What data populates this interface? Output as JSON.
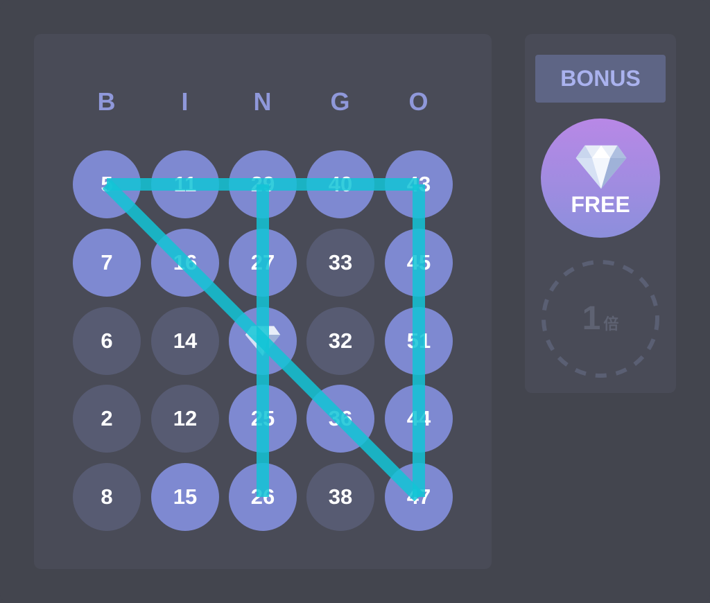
{
  "headers": [
    "B",
    "I",
    "N",
    "G",
    "O"
  ],
  "board": {
    "rows": [
      [
        {
          "label": "5",
          "marked": true
        },
        {
          "label": "11",
          "marked": true
        },
        {
          "label": "29",
          "marked": true
        },
        {
          "label": "40",
          "marked": true
        },
        {
          "label": "43",
          "marked": true
        }
      ],
      [
        {
          "label": "7",
          "marked": true
        },
        {
          "label": "16",
          "marked": true
        },
        {
          "label": "27",
          "marked": true
        },
        {
          "label": "33",
          "marked": false
        },
        {
          "label": "45",
          "marked": true
        }
      ],
      [
        {
          "label": "6",
          "marked": false
        },
        {
          "label": "14",
          "marked": false
        },
        {
          "label": "",
          "marked": true,
          "free": true
        },
        {
          "label": "32",
          "marked": false
        },
        {
          "label": "51",
          "marked": true
        }
      ],
      [
        {
          "label": "2",
          "marked": false
        },
        {
          "label": "12",
          "marked": false
        },
        {
          "label": "25",
          "marked": true
        },
        {
          "label": "36",
          "marked": true
        },
        {
          "label": "44",
          "marked": true
        }
      ],
      [
        {
          "label": "8",
          "marked": false
        },
        {
          "label": "15",
          "marked": true
        },
        {
          "label": "26",
          "marked": true
        },
        {
          "label": "38",
          "marked": false
        },
        {
          "label": "47",
          "marked": true
        }
      ]
    ]
  },
  "winning_lines": [
    {
      "type": "row",
      "index": 0
    },
    {
      "type": "column",
      "index": 2
    },
    {
      "type": "column",
      "index": 4
    },
    {
      "type": "diagonal",
      "direction": "main"
    }
  ],
  "side_panel": {
    "bonus_label": "BONUS",
    "free_label": "FREE",
    "multiplier_value": "1",
    "multiplier_unit": "倍"
  },
  "colors": {
    "marked": "#7e89d1",
    "unmarked": "#575b72",
    "line": "#12c4d6",
    "header": "#8f98da"
  },
  "icons": {
    "free_cell": "diamond-icon",
    "free_token": "diamond-icon"
  }
}
